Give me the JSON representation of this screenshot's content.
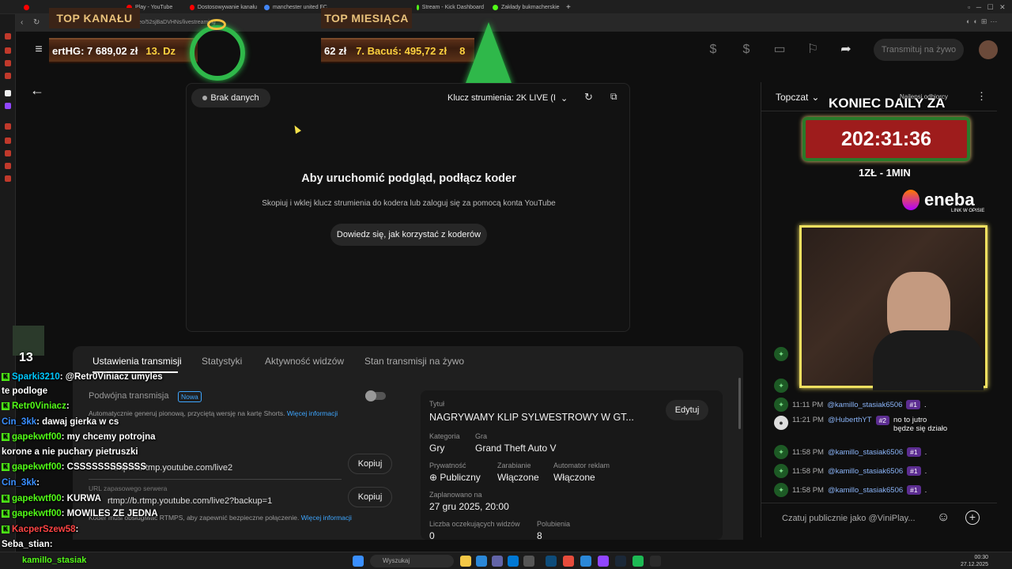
{
  "browser": {
    "tabs": [
      {
        "label": "",
        "color": "#ff0000"
      },
      {
        "label": "Play - YouTube",
        "color": "#ff0000"
      },
      {
        "label": "Dostosowywanie kanału",
        "color": "#ff0000"
      },
      {
        "label": "manchester united FC",
        "color": "#4285f4"
      },
      {
        "label": "",
        "color": "#888888"
      },
      {
        "label": "Stream - Kick Dashboard",
        "color": "#53fc18"
      },
      {
        "label": "Zakłady bukmacherskie",
        "color": "#53fc18"
      }
    ],
    "new_tab": "+",
    "url": "eo/52sjBaDVHNs/livestreaming"
  },
  "overlay": {
    "top_channel_title": "TOP KANAŁU",
    "top_channel_text": "ertHG: 7 689,02 zł",
    "top_channel_next": "13. Dz",
    "top_month_title": "TOP MIESIĄCA",
    "top_month_text": "62 zł",
    "top_month_entry": "7. Bacuś: 495,72 zł",
    "top_month_next": "8",
    "daily_title": "KONIEC DAILY ZA",
    "daily_timer": "202:31:36",
    "daily_rate": "1ZŁ - 1MIN",
    "eneba_logo": "eneba",
    "eneba_sub": "LINK W OPISIE",
    "viewer_count": "13"
  },
  "header": {
    "menu_icon": "hamburger-icon",
    "stream_button": "Transmituj na żywo"
  },
  "preview": {
    "status": "Brak danych",
    "stream_key": "Klucz strumienia: 2K LIVE (I",
    "heading": "Aby uruchomić podgląd, podłącz koder",
    "subtext": "Skopiuj i wklej klucz strumienia do kodera lub zaloguj się za pomocą konta YouTube",
    "learn_button": "Dowiedz się, jak korzystać z koderów"
  },
  "tabs": [
    "Ustawienia transmisji",
    "Statystyki",
    "Aktywność widzów",
    "Stan transmisji na żywo"
  ],
  "settings": {
    "dual_label": "Podwójna transmisja",
    "dual_badge": "Nowa",
    "dual_desc": "Automatycznie generuj pionową, przyciętą wersję na kartę Shorts.",
    "dual_link": "Więcej informacji",
    "url_value": "rtmp://a.rtmp.youtube.com/live2",
    "copy_label": "Kopiuj",
    "backup_label": "URL zapasowego serwera",
    "backup_value": "rtmp://b.rtmp.youtube.com/live2?backup=1",
    "rtmps_desc": "Koder musi obsługiwać RTMPS, aby zapewnić bezpieczne połączenie.",
    "rtmps_link": "Więcej informacji"
  },
  "details": {
    "title_label": "Tytuł",
    "title": "NAGRYWAMY KLIP SYLWESTROWY W GT...",
    "edit": "Edytuj",
    "category_label": "Kategoria",
    "category": "Gry",
    "game_label": "Gra",
    "game": "Grand Theft Auto V",
    "privacy_label": "Prywatność",
    "privacy": "Publiczny",
    "monetization_label": "Zarabianie",
    "monetization": "Włączone",
    "ads_label": "Automator reklam",
    "ads": "Włączone",
    "scheduled_label": "Zaplanowano na",
    "scheduled": "27 gru 2025, 20:00",
    "waiting_label": "Liczba oczekujących widzów",
    "waiting": "0",
    "likes_label": "Polubienia",
    "likes": "8"
  },
  "chat": {
    "mode": "Topczat",
    "top_viewers": "Najlepsi odbiorcy",
    "input_placeholder": "Czatuj publicznie jako @ViniPlay...",
    "messages": [
      {
        "time": "11:11 PM",
        "user": "@kamillo_stasiak6506",
        "badge": "#1",
        "text": "."
      },
      {
        "time": "11:21 PM",
        "user": "@HuberthYT",
        "badge": "#2",
        "text": "no to jutro będze się działo"
      },
      {
        "time": "11:58 PM",
        "user": "@kamillo_stasiak6506",
        "badge": "#1",
        "text": "."
      },
      {
        "time": "11:58 PM",
        "user": "@kamillo_stasiak6506",
        "badge": "#1",
        "text": "."
      },
      {
        "time": "11:58 PM",
        "user": "@kamillo_stasiak6506",
        "badge": "#1",
        "text": "."
      }
    ]
  },
  "kick_chat": [
    {
      "user": "Sparki3210",
      "text": ": @Retr0Viniacz umyles",
      "color": "#00c8ff"
    },
    {
      "user": "",
      "text": "te podloge",
      "color": "#ffffff"
    },
    {
      "user": "Retr0Viniacz",
      "text": ": ",
      "color": "#53fc18"
    },
    {
      "user": "Cin_3kk",
      "text": ": dawaj gierka w cs",
      "color": "#3a8fff"
    },
    {
      "user": "gapekwtf00",
      "text": ": my chcemy potrojna",
      "color": "#53fc18"
    },
    {
      "user": "",
      "text": "korone a nie puchary pietruszki",
      "color": "#ffffff"
    },
    {
      "user": "gapekwtf00",
      "text": ": CSSSSSSSSSSSS",
      "color": "#53fc18"
    },
    {
      "user": "Cin_3kk",
      "text": ":",
      "color": "#3a8fff"
    },
    {
      "user": "gapekwtf00",
      "text": ": KURWA",
      "color": "#53fc18"
    },
    {
      "user": "gapekwtf00",
      "text": ": MOWILES ZE JEDNA",
      "color": "#53fc18"
    },
    {
      "user": "KacperSzew58",
      "text": ":",
      "color": "#ff4444"
    },
    {
      "user": "Seba_stian",
      "text": ":",
      "color": "#ffffff"
    }
  ],
  "taskbar": {
    "search_placeholder": "Wyszukaj",
    "user_label": "kamillo_stasiak",
    "time": "00:30",
    "date": "27.12.2025"
  }
}
